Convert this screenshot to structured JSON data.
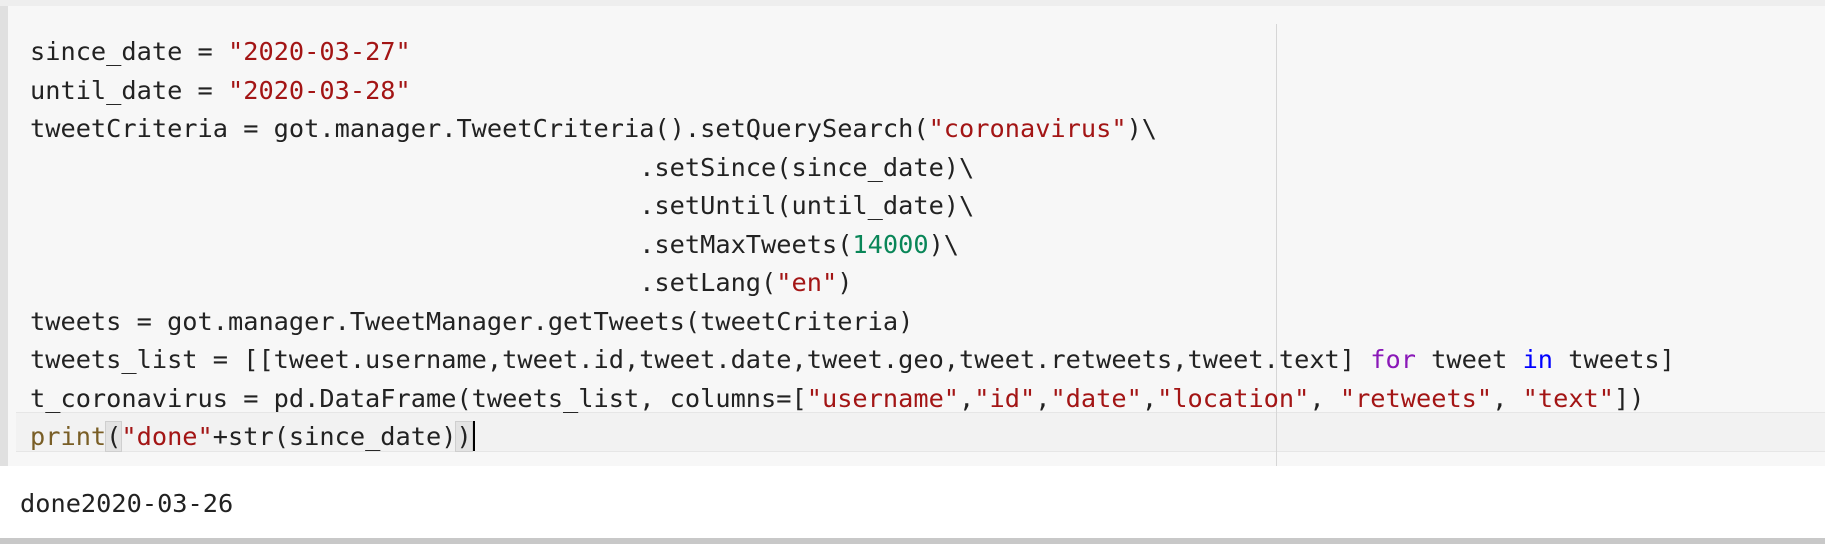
{
  "cell": {
    "code_lines": [
      [
        {
          "t": "since_date = ",
          "c": "plain"
        },
        {
          "t": "\"2020-03-27\"",
          "c": "str"
        }
      ],
      [
        {
          "t": "until_date = ",
          "c": "plain"
        },
        {
          "t": "\"2020-03-28\"",
          "c": "str"
        }
      ],
      [
        {
          "t": "tweetCriteria = got.manager.TweetCriteria().setQuerySearch(",
          "c": "plain"
        },
        {
          "t": "\"coronavirus\"",
          "c": "str"
        },
        {
          "t": ")\\",
          "c": "plain"
        }
      ],
      [
        {
          "t": "                                        .setSince(since_date)\\",
          "c": "plain"
        }
      ],
      [
        {
          "t": "                                        .setUntil(until_date)\\",
          "c": "plain"
        }
      ],
      [
        {
          "t": "                                        .setMaxTweets(",
          "c": "plain"
        },
        {
          "t": "14000",
          "c": "num"
        },
        {
          "t": ")\\",
          "c": "plain"
        }
      ],
      [
        {
          "t": "                                        .setLang(",
          "c": "plain"
        },
        {
          "t": "\"en\"",
          "c": "str"
        },
        {
          "t": ")",
          "c": "plain"
        }
      ],
      [
        {
          "t": "tweets = got.manager.TweetManager.getTweets(tweetCriteria)",
          "c": "plain"
        }
      ],
      [
        {
          "t": "tweets_list = [[tweet.username,tweet.id,tweet.date,tweet.geo,tweet.retweets,tweet.text] ",
          "c": "plain"
        },
        {
          "t": "for",
          "c": "kw2"
        },
        {
          "t": " tweet ",
          "c": "plain"
        },
        {
          "t": "in",
          "c": "kw"
        },
        {
          "t": " tweets]",
          "c": "plain"
        }
      ],
      [
        {
          "t": "t_coronavirus = pd.DataFrame(tweets_list, columns=[",
          "c": "plain"
        },
        {
          "t": "\"username\"",
          "c": "str"
        },
        {
          "t": ",",
          "c": "plain"
        },
        {
          "t": "\"id\"",
          "c": "str"
        },
        {
          "t": ",",
          "c": "plain"
        },
        {
          "t": "\"date\"",
          "c": "str"
        },
        {
          "t": ",",
          "c": "plain"
        },
        {
          "t": "\"location\"",
          "c": "str"
        },
        {
          "t": ", ",
          "c": "plain"
        },
        {
          "t": "\"retweets\"",
          "c": "str"
        },
        {
          "t": ", ",
          "c": "plain"
        },
        {
          "t": "\"text\"",
          "c": "str"
        },
        {
          "t": "])",
          "c": "plain"
        }
      ],
      [
        {
          "t": "print",
          "c": "builtin"
        },
        {
          "t": "(",
          "c": "bracket"
        },
        {
          "t": "\"done\"",
          "c": "str"
        },
        {
          "t": "+str(since_date)",
          "c": "plain"
        },
        {
          "t": ")",
          "c": "bracket"
        }
      ]
    ],
    "output_text": "done2020-03-26"
  },
  "colors": {
    "string": "#a31515",
    "number": "#098658",
    "keyword_in": "#0000ff",
    "keyword_for": "#8a19b8",
    "builtin": "#795e26",
    "plain": "#222222"
  }
}
